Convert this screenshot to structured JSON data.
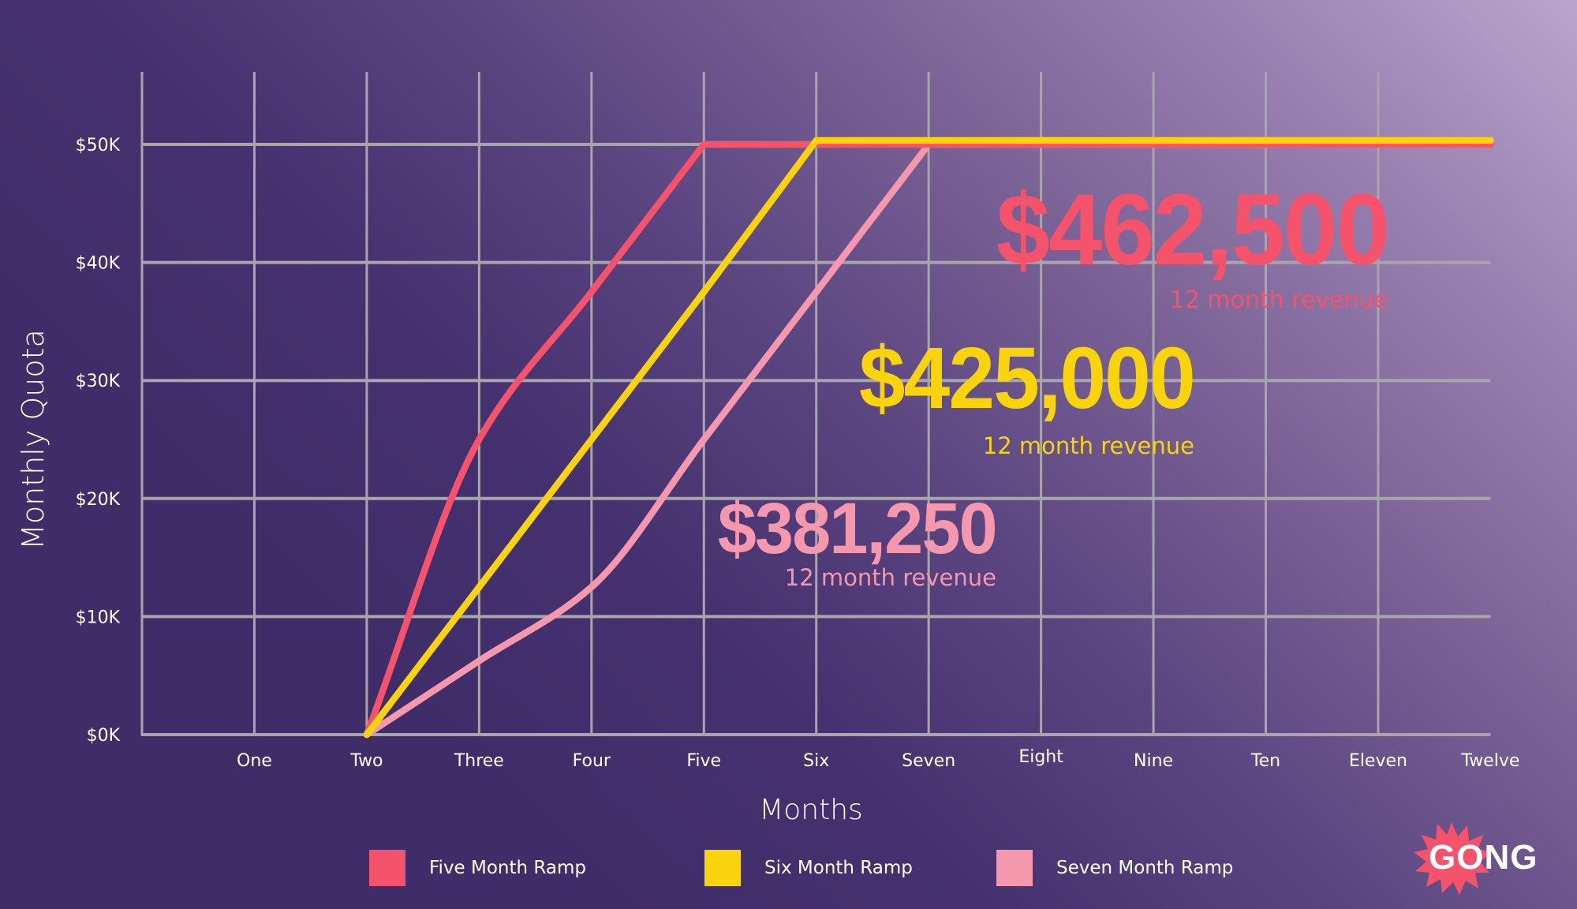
{
  "chart_data": {
    "type": "line",
    "title": "",
    "xlabel": "Months",
    "ylabel": "Monthly Quota",
    "categories": [
      "One",
      "Two",
      "Three",
      "Four",
      "Five",
      "Six",
      "Seven",
      "Eight",
      "Nine",
      "Ten",
      "Eleven",
      "Twelve"
    ],
    "x": [
      1,
      2,
      3,
      4,
      5,
      6,
      7,
      8,
      9,
      10,
      11,
      12
    ],
    "yticks": [
      0,
      10,
      20,
      30,
      40,
      50
    ],
    "ytick_labels": [
      "$0K",
      "$10K",
      "$20K",
      "$30K",
      "$40K",
      "$50K"
    ],
    "ylim": [
      0,
      50
    ],
    "xlim": [
      0,
      12
    ],
    "y_units": "thousands of USD",
    "grid": true,
    "legend_position": "bottom",
    "series": [
      {
        "name": "Five Month Ramp",
        "color": "#f5526c",
        "x": [
          2,
          3,
          4,
          5,
          6,
          7,
          8,
          9,
          10,
          11,
          12
        ],
        "values": [
          0,
          25,
          37.5,
          50,
          50,
          50,
          50,
          50,
          50,
          50,
          50
        ]
      },
      {
        "name": "Six Month Ramp",
        "color": "#f9d30b",
        "x": [
          2,
          3,
          4,
          5,
          6,
          7,
          8,
          9,
          10,
          11,
          12
        ],
        "values": [
          0,
          12.5,
          25,
          37.5,
          50,
          50,
          50,
          50,
          50,
          50,
          50
        ]
      },
      {
        "name": "Seven Month Ramp",
        "color": "#f597ad",
        "x": [
          2,
          3,
          4,
          5,
          6,
          7,
          8,
          9,
          10,
          11,
          12
        ],
        "values": [
          0,
          6.25,
          12.5,
          25,
          37.5,
          50,
          50,
          50,
          50,
          50,
          50
        ]
      }
    ],
    "annotations": [
      {
        "series": "Five Month Ramp",
        "value": "$462,500",
        "caption": "12 month revenue",
        "color": "#f5526c"
      },
      {
        "series": "Six Month Ramp",
        "value": "$425,000",
        "caption": "12 month revenue",
        "color": "#f9d30b"
      },
      {
        "series": "Seven Month Ramp",
        "value": "$381,250",
        "caption": "12 month revenue",
        "color": "#f597ad"
      }
    ]
  },
  "colors": {
    "background_dark": "#3f2d6a",
    "background_light": "#bba5cc",
    "grid": "#a8a5ab",
    "text": "#ffffff"
  },
  "logo": {
    "text": "GONG",
    "icon": "starburst-icon",
    "color": "#f5526c"
  }
}
